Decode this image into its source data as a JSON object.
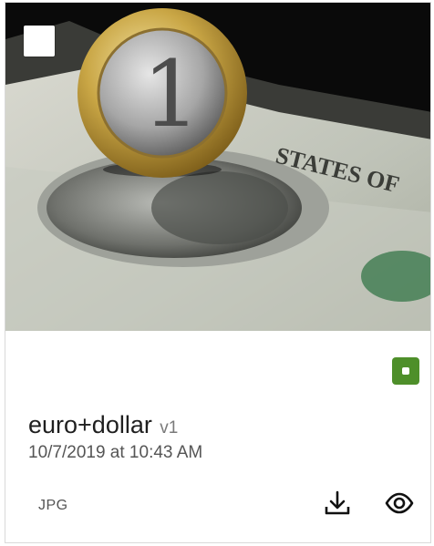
{
  "asset": {
    "name": "euro+dollar",
    "version": "v1",
    "timestamp": "10/7/2019 at 10:43 AM",
    "file_type": "JPG"
  },
  "thumbnail": {
    "coin_number": "1",
    "banknote_text": "STATES OF"
  },
  "icons": {
    "select": "checkbox",
    "status": "status-square-icon",
    "download": "download-icon",
    "preview": "eye-icon"
  },
  "colors": {
    "status_badge": "#4e8f2a",
    "icon": "#111111"
  }
}
